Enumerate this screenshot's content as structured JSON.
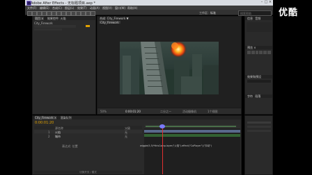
{
  "window": {
    "title": "Adobe After Effects - 无标题项目.aep *"
  },
  "menu": [
    "文件(F)",
    "编辑(E)",
    "合成(C)",
    "图层(L)",
    "效果(T)",
    "动画(A)",
    "视图(V)",
    "窗口(W)",
    "帮助(H)"
  ],
  "workspace": {
    "label": "工作区:",
    "value": "标准"
  },
  "search": {
    "placeholder": "搜索帮助"
  },
  "project": {
    "tab": "项目 ×",
    "effects_tab": "效果控件: 火焰",
    "item": "City_Firework"
  },
  "composition": {
    "tab": "合成: City_Firework ▼",
    "subtab": "City_Firework",
    "zoom": "50%",
    "time": "0:00:01:20",
    "quality": "二分之一",
    "camera": "活动摄像机",
    "views": "1个视图"
  },
  "right_panels": {
    "info": "信息",
    "audio": "音频",
    "preview": "预览 ×",
    "effects_presets": "效果和预设",
    "character": "字符",
    "paragraph": "段落"
  },
  "timeline": {
    "tab": "City_Firework ×",
    "render_tab": "渲染队列",
    "timecode": "0:00:01:20",
    "columns": [
      "源名称",
      "父级"
    ],
    "layers": [
      {
        "num": "1",
        "name": "火焰",
        "parent": "无"
      },
      {
        "num": "2",
        "name": "城市",
        "parent": "无"
      }
    ],
    "property": {
      "label": "表达式: 位置",
      "expression": "wiggle(5,5)*thisComp.layer(\"火焰\").effect(\"CoPlayer\")(\"抖动\")"
    },
    "switch_label": "切换开关 / 模式"
  },
  "watermark": {
    "text": "优酷"
  },
  "colors": {
    "accent": "#e0a000",
    "timeline_cursor": "#7a7aff",
    "layer1": "#7e9bd4",
    "layer2": "#3f8f3f"
  }
}
